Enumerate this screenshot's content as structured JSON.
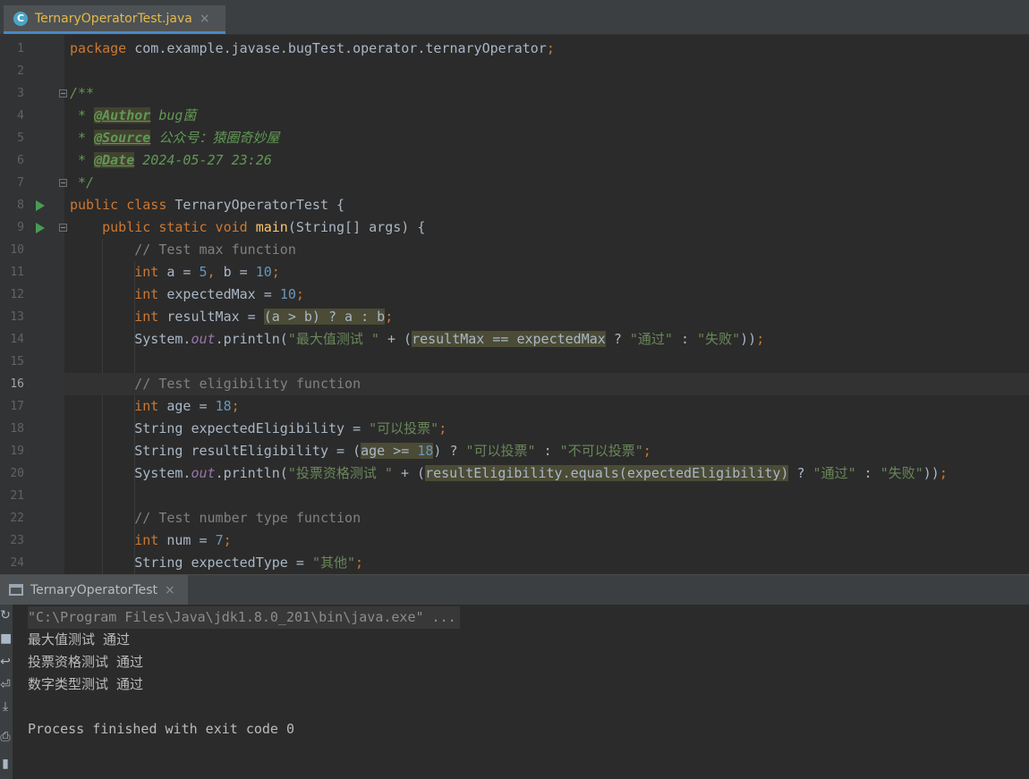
{
  "editor_tab": {
    "icon": "C",
    "title": "TernaryOperatorTest.java",
    "close": "×"
  },
  "current_line": 16,
  "code_lines": [
    {
      "n": "1",
      "tokens": [
        {
          "t": "kw",
          "v": "package "
        },
        {
          "t": "id",
          "v": "com.example.javase.bugTest.operator.ternaryOperator"
        },
        {
          "t": "kw",
          "v": ";"
        }
      ]
    },
    {
      "n": "2",
      "tokens": []
    },
    {
      "n": "3",
      "fold": true,
      "tokens": [
        {
          "t": "doc",
          "v": "/**"
        }
      ]
    },
    {
      "n": "4",
      "tokens": [
        {
          "t": "doc",
          "v": " * "
        },
        {
          "t": "tag",
          "v": "@Author"
        },
        {
          "t": "doc",
          "v": " bug菌"
        }
      ]
    },
    {
      "n": "5",
      "tokens": [
        {
          "t": "doc",
          "v": " * "
        },
        {
          "t": "tag",
          "v": "@Source"
        },
        {
          "t": "doc",
          "v": " 公众号：猿圈奇妙屋"
        }
      ]
    },
    {
      "n": "6",
      "tokens": [
        {
          "t": "doc",
          "v": " * "
        },
        {
          "t": "tag",
          "v": "@Date"
        },
        {
          "t": "doc",
          "v": " 2024-05-27 23:26"
        }
      ]
    },
    {
      "n": "7",
      "fold": true,
      "tokens": [
        {
          "t": "doc",
          "v": " */"
        }
      ]
    },
    {
      "n": "8",
      "run": true,
      "tokens": [
        {
          "t": "kw",
          "v": "public class "
        },
        {
          "t": "id",
          "v": "TernaryOperatorTest {"
        }
      ]
    },
    {
      "n": "9",
      "run": true,
      "fold": true,
      "tokens": [
        {
          "t": "id",
          "v": "    "
        },
        {
          "t": "kw",
          "v": "public static void "
        },
        {
          "t": "fn",
          "v": "main"
        },
        {
          "t": "id",
          "v": "(String[] args) {"
        }
      ]
    },
    {
      "n": "10",
      "tokens": [
        {
          "t": "id",
          "v": "        "
        },
        {
          "t": "cmt",
          "v": "// Test max function"
        }
      ]
    },
    {
      "n": "11",
      "tokens": [
        {
          "t": "id",
          "v": "        "
        },
        {
          "t": "kw",
          "v": "int "
        },
        {
          "t": "id",
          "v": "a = "
        },
        {
          "t": "num",
          "v": "5"
        },
        {
          "t": "kw",
          "v": ", "
        },
        {
          "t": "id",
          "v": "b = "
        },
        {
          "t": "num",
          "v": "10"
        },
        {
          "t": "kw",
          "v": ";"
        }
      ]
    },
    {
      "n": "12",
      "tokens": [
        {
          "t": "id",
          "v": "        "
        },
        {
          "t": "kw",
          "v": "int "
        },
        {
          "t": "id",
          "v": "expectedMax = "
        },
        {
          "t": "num",
          "v": "10"
        },
        {
          "t": "kw",
          "v": ";"
        }
      ]
    },
    {
      "n": "13",
      "tokens": [
        {
          "t": "id",
          "v": "        "
        },
        {
          "t": "kw",
          "v": "int "
        },
        {
          "t": "id",
          "v": "resultMax = "
        },
        {
          "t": "id hl2",
          "v": "(a > b) ? a : b"
        },
        {
          "t": "kw",
          "v": ";"
        }
      ]
    },
    {
      "n": "14",
      "tokens": [
        {
          "t": "id",
          "v": "        System."
        },
        {
          "t": "fld",
          "v": "out"
        },
        {
          "t": "id",
          "v": ".println("
        },
        {
          "t": "str",
          "v": "\"最大值测试 \""
        },
        {
          "t": "id",
          "v": " + ("
        },
        {
          "t": "id hl2",
          "v": "resultMax == expectedMax"
        },
        {
          "t": "id",
          "v": " ? "
        },
        {
          "t": "str",
          "v": "\"通过\""
        },
        {
          "t": "id",
          "v": " : "
        },
        {
          "t": "str",
          "v": "\"失败\""
        },
        {
          "t": "id",
          "v": "))"
        },
        {
          "t": "kw",
          "v": ";"
        }
      ]
    },
    {
      "n": "15",
      "tokens": []
    },
    {
      "n": "16",
      "tokens": [
        {
          "t": "id",
          "v": "        "
        },
        {
          "t": "cmt",
          "v": "// Test eligibility function"
        }
      ]
    },
    {
      "n": "17",
      "tokens": [
        {
          "t": "id",
          "v": "        "
        },
        {
          "t": "kw",
          "v": "int "
        },
        {
          "t": "id",
          "v": "age = "
        },
        {
          "t": "num",
          "v": "18"
        },
        {
          "t": "kw",
          "v": ";"
        }
      ]
    },
    {
      "n": "18",
      "tokens": [
        {
          "t": "id",
          "v": "        String expectedEligibility = "
        },
        {
          "t": "str",
          "v": "\"可以投票\""
        },
        {
          "t": "kw",
          "v": ";"
        }
      ]
    },
    {
      "n": "19",
      "tokens": [
        {
          "t": "id",
          "v": "        String resultEligibility = ("
        },
        {
          "t": "id hl2",
          "v": "age >= "
        },
        {
          "t": "num hl2",
          "v": "18"
        },
        {
          "t": "id",
          "v": ") ? "
        },
        {
          "t": "str",
          "v": "\"可以投票\""
        },
        {
          "t": "id",
          "v": " : "
        },
        {
          "t": "str",
          "v": "\"不可以投票\""
        },
        {
          "t": "kw",
          "v": ";"
        }
      ]
    },
    {
      "n": "20",
      "tokens": [
        {
          "t": "id",
          "v": "        System."
        },
        {
          "t": "fld",
          "v": "out"
        },
        {
          "t": "id",
          "v": ".println("
        },
        {
          "t": "str",
          "v": "\"投票资格测试 \""
        },
        {
          "t": "id",
          "v": " + ("
        },
        {
          "t": "id hl2",
          "v": "resultEligibility.equals(expectedEligibility)"
        },
        {
          "t": "id",
          "v": " ? "
        },
        {
          "t": "str",
          "v": "\"通过\""
        },
        {
          "t": "id",
          "v": " : "
        },
        {
          "t": "str",
          "v": "\"失败\""
        },
        {
          "t": "id",
          "v": "))"
        },
        {
          "t": "kw",
          "v": ";"
        }
      ]
    },
    {
      "n": "21",
      "tokens": []
    },
    {
      "n": "22",
      "tokens": [
        {
          "t": "id",
          "v": "        "
        },
        {
          "t": "cmt",
          "v": "// Test number type function"
        }
      ]
    },
    {
      "n": "23",
      "tokens": [
        {
          "t": "id",
          "v": "        "
        },
        {
          "t": "kw",
          "v": "int "
        },
        {
          "t": "id",
          "v": "num = "
        },
        {
          "t": "num",
          "v": "7"
        },
        {
          "t": "kw",
          "v": ";"
        }
      ]
    },
    {
      "n": "24",
      "tokens": [
        {
          "t": "id",
          "v": "        String expectedType = "
        },
        {
          "t": "str",
          "v": "\"其他\""
        },
        {
          "t": "kw",
          "v": ";"
        }
      ]
    }
  ],
  "run_tab": {
    "title": "TernaryOperatorTest",
    "close": "×"
  },
  "console": {
    "command": "\"C:\\Program Files\\Java\\jdk1.8.0_201\\bin\\java.exe\" ...",
    "output": [
      "最大值测试 通过",
      "投票资格测试 通过",
      "数字类型测试 通过",
      "",
      "Process finished with exit code 0"
    ]
  },
  "colors": {
    "accent": "#4a88c7",
    "keyword": "#cc7832",
    "string": "#6a8759",
    "number": "#6897bb",
    "comment": "#808080",
    "doc_comment": "#629755",
    "run_icon": "#499c54"
  }
}
